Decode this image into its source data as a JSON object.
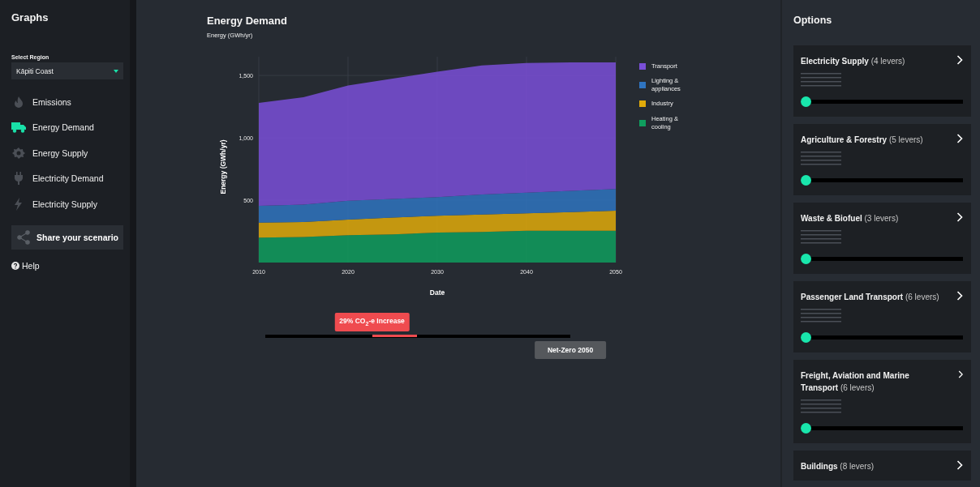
{
  "sidebar": {
    "title": "Graphs",
    "region_label": "Select Region",
    "region": "Kāpiti Coast",
    "items": [
      {
        "label": "Emissions",
        "selected": false
      },
      {
        "label": "Energy Demand",
        "selected": true
      },
      {
        "label": "Energy Supply",
        "selected": false
      },
      {
        "label": "Electricity Demand",
        "selected": false
      },
      {
        "label": "Electricity Supply",
        "selected": false
      }
    ],
    "share_button": "Share your scenario",
    "help": "Help"
  },
  "main": {
    "title": "Energy Demand",
    "subtitle": "Energy (GWh/yr)",
    "chart_data": {
      "type": "area",
      "stacked": true,
      "xlabel": "Date",
      "ylabel": "Energy (GWh/yr)",
      "x": [
        2010,
        2015,
        2020,
        2025,
        2030,
        2035,
        2040,
        2045,
        2050
      ],
      "xlim": [
        2010,
        2050
      ],
      "grid": true,
      "legend": true,
      "xticks": [
        2010,
        2020,
        2030,
        2040,
        2050
      ],
      "yticks": [
        {
          "value": 500,
          "label": "500"
        },
        {
          "value": 1000,
          "label": "1,000"
        },
        {
          "value": 1500,
          "label": "1,500"
        }
      ],
      "ylim": [
        0,
        1650
      ],
      "series": [
        {
          "name": "Transport",
          "color": "#7a4fd8",
          "values": [
            825,
            860,
            925,
            965,
            1005,
            1035,
            1040,
            1030,
            1015
          ]
        },
        {
          "name": "Lighting & appliances",
          "color": "#2f74c0",
          "values": [
            135,
            140,
            150,
            150,
            150,
            160,
            165,
            170,
            175
          ]
        },
        {
          "name": "Industry",
          "color": "#e0aa0a",
          "values": [
            120,
            120,
            125,
            135,
            135,
            140,
            140,
            150,
            160
          ]
        },
        {
          "name": "Heating & cooling",
          "color": "#0f9e5e",
          "values": [
            200,
            205,
            220,
            225,
            240,
            245,
            255,
            255,
            255
          ]
        }
      ]
    },
    "emissions_slider": {
      "marker_label": "29% CO$_{2}$-e Increase",
      "target_label": "Net-Zero 2050"
    }
  },
  "options": {
    "title": "Options",
    "cards": [
      {
        "name": "Electricity Supply",
        "count": "(4 levers)",
        "level": 0
      },
      {
        "name": "Agriculture & Forestry",
        "count": "(5 levers)",
        "level": 0
      },
      {
        "name": "Waste & Biofuel",
        "count": "(3 levers)",
        "level": 0
      },
      {
        "name": "Passenger Land Transport",
        "count": "(6 levers)",
        "level": 0
      },
      {
        "name": "Freight, Aviation and Marine Transport",
        "count": "(6 levers)",
        "level": 0
      },
      {
        "name": "Buildings",
        "count": "(8 levers)"
      }
    ]
  }
}
